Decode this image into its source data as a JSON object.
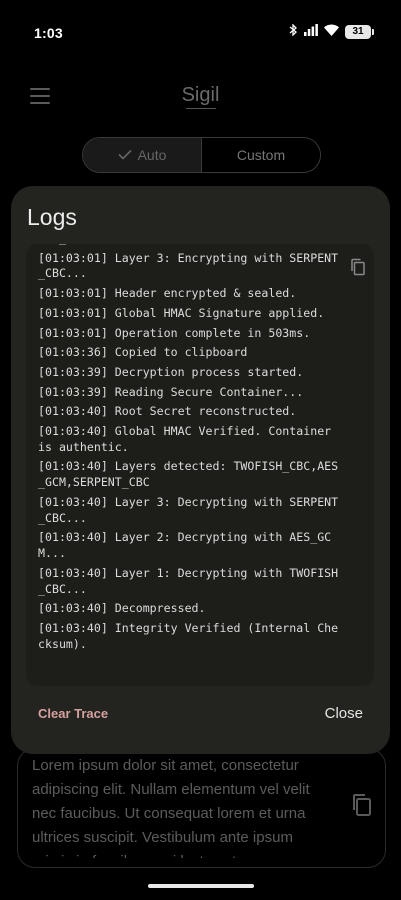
{
  "status_bar": {
    "time": "1:03",
    "battery": "31"
  },
  "app": {
    "title": "Sigil",
    "mode_toggle": {
      "auto_label": "Auto",
      "custom_label": "Custom"
    },
    "background_text": "Lorem ipsum dolor sit amet, consectetur adipiscing elit. Nullam elementum vel velit nec faucibus. Ut consequat lorem et urna ultrices suscipit. Vestibulum ante ipsum primis in faucibus orci luctus et"
  },
  "dialog": {
    "title": "Logs",
    "log_lines": [
      "AES_GCM...",
      "[01:03:01] Layer 3: Encrypting with SERPENT_CBC...",
      "[01:03:01] Header encrypted & sealed.",
      "[01:03:01] Global HMAC Signature applied.",
      "[01:03:01] Operation complete in 503ms.",
      "[01:03:36] Copied to clipboard",
      "[01:03:39] Decryption process started.",
      "[01:03:39] Reading Secure Container...",
      "[01:03:40] Root Secret reconstructed.",
      "[01:03:40] Global HMAC Verified. Container is authentic.",
      "[01:03:40] Layers detected: TWOFISH_CBC,AES_GCM,SERPENT_CBC",
      "[01:03:40] Layer 3: Decrypting with SERPENT_CBC...",
      "[01:03:40] Layer 2: Decrypting with AES_GCM...",
      "[01:03:40] Layer 1: Decrypting with TWOFISH_CBC...",
      "[01:03:40] Decompressed.",
      "[01:03:40] Integrity Verified (Internal Checksum)."
    ],
    "clear_label": "Clear Trace",
    "close_label": "Close"
  },
  "colors": {
    "dialog_background": "#23231f",
    "clear_accent": "#d6a09d"
  }
}
